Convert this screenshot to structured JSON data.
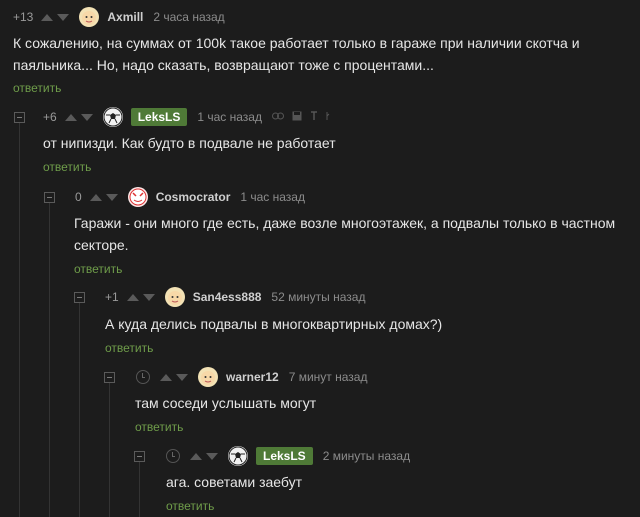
{
  "comments": [
    {
      "rating": "+13",
      "author": "Axmill",
      "time": "2 часа назад",
      "text": "К сожалению, на суммах от 100k такое работает только в гараже при наличии скотча и паяльника... Но, надо сказать, возвращают тоже с процентами...",
      "reply": "ответить"
    },
    {
      "rating": "+6",
      "author": "LeksLS",
      "time": "1 час назад",
      "text": "от нипизди. Как будто в подвале не работает",
      "reply": "ответить"
    },
    {
      "rating": "0",
      "author": "Cosmocrator",
      "time": "1 час назад",
      "text": "Гаражи - они много где есть, даже возле многоэтажек, а подвалы только в частном секторе.",
      "reply": "ответить"
    },
    {
      "rating": "+1",
      "author": "San4ess888",
      "time": "52 минуты назад",
      "text": "А куда делись подвалы в многоквартирных домах?)",
      "reply": "ответить"
    },
    {
      "rating": "",
      "author": "warner12",
      "time": "7 минут назад",
      "text": "там соседи услышать могут",
      "reply": "ответить"
    },
    {
      "rating": "",
      "author": "LeksLS",
      "time": "2 минуты назад",
      "text": "ага. советами заебут",
      "reply": "ответить"
    }
  ],
  "icons": {
    "link": "link-icon",
    "save": "save-icon",
    "pin": "pin-icon"
  },
  "colors": {
    "background": "#1c1c1c",
    "reply": "#6f9d4a",
    "badge": "#4f7a37"
  }
}
